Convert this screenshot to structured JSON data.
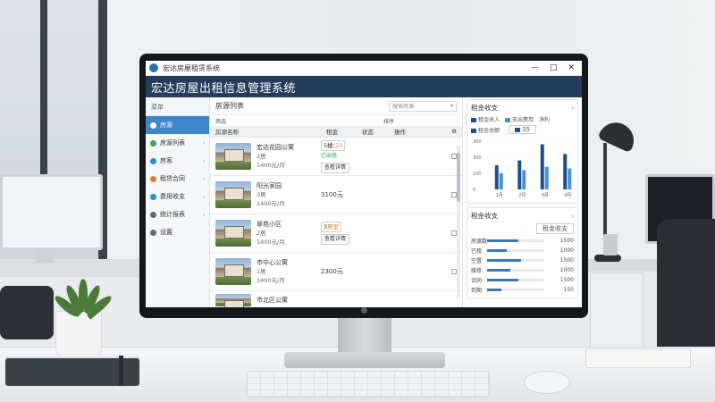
{
  "window": {
    "title": "宏达房屋租赁系统",
    "controls": [
      "—",
      "□",
      "✕"
    ]
  },
  "banner": {
    "title": "宏达房屋出租信息管理系统"
  },
  "sidebar": {
    "header": "菜单",
    "items": [
      {
        "label": "房源",
        "active": true,
        "icon": "home-icon",
        "color": "#ffffff"
      },
      {
        "label": "房源列表",
        "active": false,
        "icon": "list-icon",
        "color": "#3aa856"
      },
      {
        "label": "房客",
        "active": false,
        "icon": "user-icon",
        "color": "#2e8bd0"
      },
      {
        "label": "租赁合同",
        "active": false,
        "icon": "contract-icon",
        "color": "#d9822b"
      },
      {
        "label": "费用收支",
        "active": false,
        "icon": "money-icon",
        "color": "#2e8bd0"
      },
      {
        "label": "统计报表",
        "active": false,
        "icon": "chart-icon",
        "color": "#5b6b7a"
      },
      {
        "label": "设置",
        "active": false,
        "icon": "gear-icon",
        "color": "#5b6b7a"
      }
    ]
  },
  "main": {
    "title": "房源列表",
    "search_placeholder": "搜索房源",
    "filter_label": "筛选",
    "filter_right": "排序",
    "columns": [
      "房源名称",
      "租金",
      "状态",
      "操作"
    ],
    "rows": [
      {
        "name": "宏达花园公寓",
        "line2": "2居",
        "line3": "1400元/月",
        "price_a": "5楼",
        "price_hl": "/23",
        "price_b": "已出租",
        "status": "查看详情"
      },
      {
        "name": "阳光家园",
        "line2": "3居",
        "line3": "1400元/月",
        "price_a": "3100元",
        "price_hl": "",
        "price_b": "",
        "status": ""
      },
      {
        "name": "翠苑小区",
        "line2": "2居",
        "line3": "1400元/月",
        "price_a": "3",
        "price_hl": "居室",
        "price_b": "",
        "status": "查看详情"
      },
      {
        "name": "市中心公寓",
        "line2": "1居",
        "line3": "1400元/月",
        "price_a": "2300元",
        "price_hl": "",
        "price_b": "",
        "status": ""
      },
      {
        "name": "市北区公寓",
        "line2": "",
        "line3": "",
        "price_a": "",
        "price_hl": "",
        "price_b": "",
        "status": ""
      }
    ]
  },
  "stats": {
    "card1": {
      "title": "租金收支",
      "legend": [
        "租金收入",
        "支出费用",
        "净利"
      ],
      "legend2_label": "租金总额",
      "big_value": "35",
      "accent_dark": "#1f4e8c",
      "accent_light": "#4a90d9"
    },
    "card2": {
      "title": "租金收支",
      "tag": "租金收支",
      "rows": [
        {
          "label": "房源数",
          "value": "1500",
          "fill": 0.55
        },
        {
          "label": "已租",
          "value": "1000",
          "fill": 0.35
        },
        {
          "label": "空置",
          "value": "1500",
          "fill": 0.6
        },
        {
          "label": "维修",
          "value": "1000",
          "fill": 0.4
        },
        {
          "label": "合同",
          "value": "1500",
          "fill": 0.55
        },
        {
          "label": "到期",
          "value": "150",
          "fill": 0.25
        }
      ]
    }
  },
  "chart_data": {
    "type": "bar",
    "title": "租金收支",
    "categories": [
      "1月",
      "2月",
      "3月",
      "4月"
    ],
    "series": [
      {
        "name": "租金收入",
        "values": [
          15,
          18,
          28,
          22
        ]
      },
      {
        "name": "支出费用",
        "values": [
          10,
          12,
          14,
          13
        ]
      }
    ],
    "yticks": [
      "300",
      "200",
      "100",
      "0"
    ],
    "ylim": [
      0,
      30
    ],
    "colors": [
      "#1f4e8c",
      "#4a90d9"
    ]
  }
}
